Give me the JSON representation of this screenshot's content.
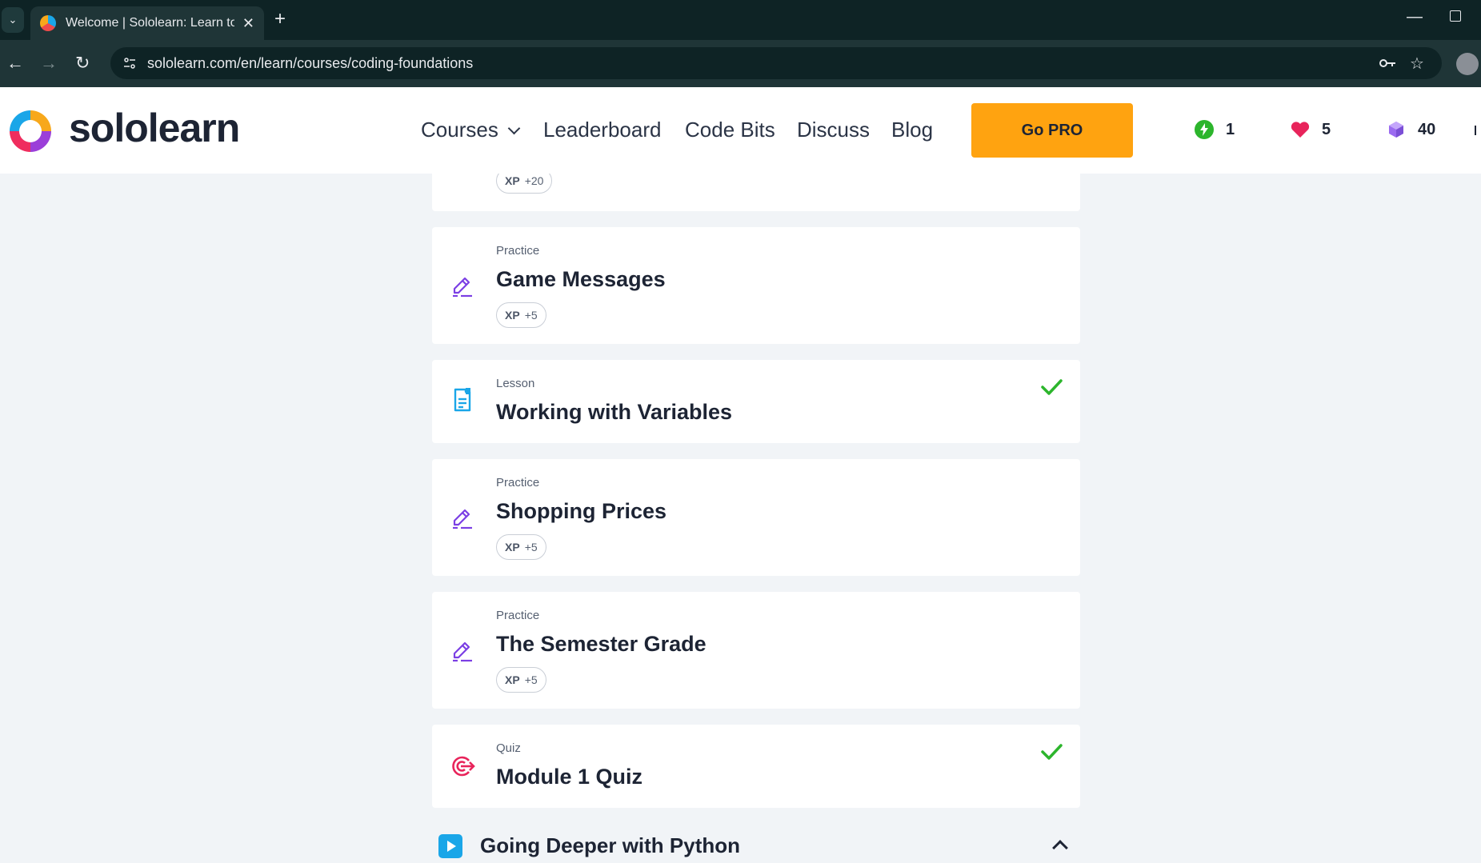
{
  "browser": {
    "tab_title": "Welcome | Sololearn: Learn to c",
    "url": "sololearn.com/en/learn/courses/coding-foundations"
  },
  "header": {
    "logo_text": "sololearn",
    "nav": [
      "Courses",
      "Leaderboard",
      "Code Bits",
      "Discuss",
      "Blog"
    ],
    "cta": "Go PRO",
    "stats": {
      "streak": "1",
      "hearts": "5",
      "gems": "40"
    }
  },
  "cards": [
    {
      "type": "",
      "title": "",
      "xp_label": "XP",
      "xp_value": "+20",
      "completed": false,
      "icon": "partial-card"
    },
    {
      "type": "Practice",
      "title": "Game Messages",
      "xp_label": "XP",
      "xp_value": "+5",
      "completed": false,
      "icon": "pencil-icon"
    },
    {
      "type": "Lesson",
      "title": "Working with Variables",
      "xp_label": "",
      "xp_value": "",
      "completed": true,
      "icon": "document-icon"
    },
    {
      "type": "Practice",
      "title": "Shopping Prices",
      "xp_label": "XP",
      "xp_value": "+5",
      "completed": false,
      "icon": "pencil-icon"
    },
    {
      "type": "Practice",
      "title": "The Semester Grade",
      "xp_label": "XP",
      "xp_value": "+5",
      "completed": false,
      "icon": "pencil-icon"
    },
    {
      "type": "Quiz",
      "title": "Module 1 Quiz",
      "xp_label": "",
      "xp_value": "",
      "completed": true,
      "icon": "target-icon"
    }
  ],
  "section": {
    "title": "Going Deeper with Python"
  },
  "colors": {
    "accent_orange": "#ffa310",
    "practice_purple": "#7b3fe4",
    "lesson_blue": "#1aa6e8",
    "quiz_red": "#e8245b",
    "check_green": "#2cb52c"
  }
}
